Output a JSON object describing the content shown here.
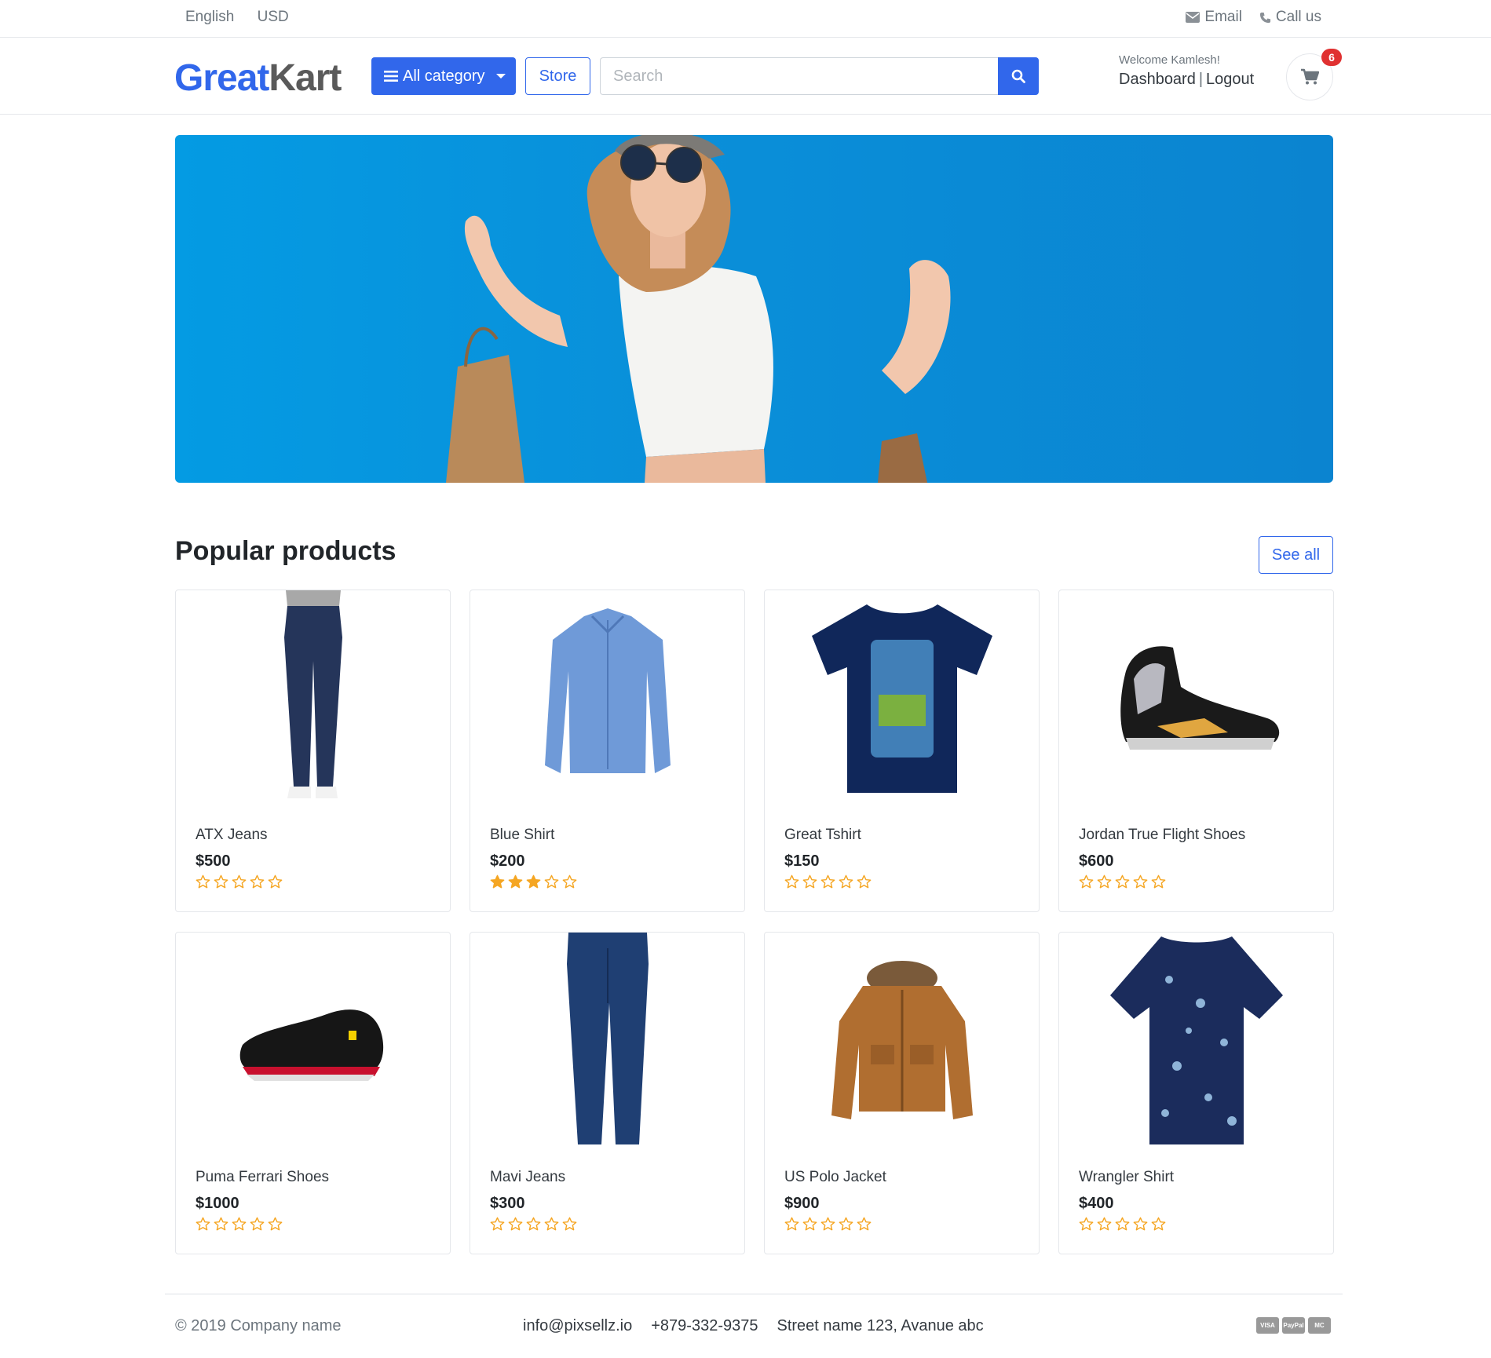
{
  "topbar": {
    "language": "English",
    "currency": "USD",
    "email": "Email",
    "call": "Call us"
  },
  "header": {
    "logo_great": "Great",
    "logo_kart": "Kart",
    "category_label": "All category",
    "store_label": "Store",
    "search_placeholder": "Search",
    "welcome": "Welcome Kamlesh!",
    "dashboard": "Dashboard",
    "logout": "Logout",
    "cart_count": "6"
  },
  "section": {
    "title": "Popular products",
    "see_all": "See all"
  },
  "products": [
    {
      "name": "ATX Jeans",
      "price": "$500",
      "rating": 0,
      "icon": "jeans-image"
    },
    {
      "name": "Blue Shirt",
      "price": "$200",
      "rating": 3,
      "icon": "shirt-image"
    },
    {
      "name": "Great Tshirt",
      "price": "$150",
      "rating": 0,
      "icon": "tshirt-image"
    },
    {
      "name": "Jordan True Flight Shoes",
      "price": "$600",
      "rating": 0,
      "icon": "sneaker-image"
    },
    {
      "name": "Puma Ferrari Shoes",
      "price": "$1000",
      "rating": 0,
      "icon": "shoe-image"
    },
    {
      "name": "Mavi Jeans",
      "price": "$300",
      "rating": 0,
      "icon": "jeans-image"
    },
    {
      "name": "US Polo Jacket",
      "price": "$900",
      "rating": 0,
      "icon": "jacket-image"
    },
    {
      "name": "Wrangler Shirt",
      "price": "$400",
      "rating": 0,
      "icon": "shirt-image"
    }
  ],
  "footer": {
    "copyright": "© 2019 Company name",
    "email": "info@pixsellz.io",
    "phone": "+879-332-9375",
    "address": "Street name 123, Avanue abc",
    "payments": [
      "VISA",
      "PayPal",
      "MC"
    ]
  },
  "colors": {
    "primary": "#3167eb",
    "star": "#f5a623",
    "badge": "#e03131"
  }
}
